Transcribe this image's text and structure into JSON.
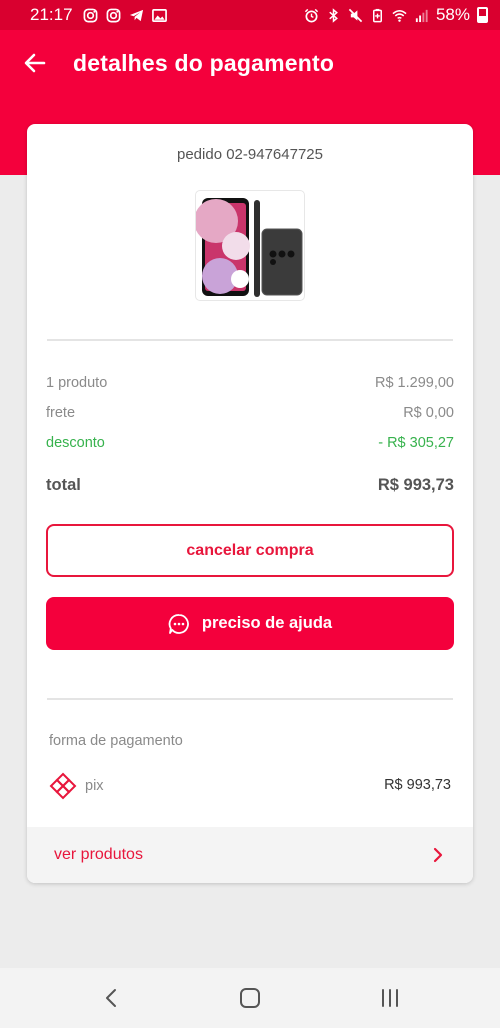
{
  "status": {
    "time": "21:17",
    "battery": "58%",
    "left_icons": [
      "instagram-icon",
      "instagram-icon",
      "telegram-icon",
      "gallery-icon"
    ],
    "right_icons": [
      "alarm-icon",
      "bluetooth-icon",
      "mute-icon",
      "battery-saver-icon",
      "wifi-icon",
      "signal-icon",
      "battery-icon"
    ]
  },
  "header": {
    "title": "detalhes do pagamento",
    "back_icon": "back-arrow-icon"
  },
  "order": {
    "id_label": "pedido 02-947647725",
    "product_image": "samsung-phone-image",
    "summary": [
      {
        "label": "1 produto",
        "value": "R$ 1.299,00"
      },
      {
        "label": "frete",
        "value": "R$ 0,00"
      },
      {
        "label": "desconto",
        "value": "- R$ 305,27"
      }
    ],
    "total": {
      "label": "total",
      "value": "R$ 993,73"
    }
  },
  "actions": {
    "cancel_label": "cancelar compra",
    "help_label": "preciso de ajuda",
    "help_icon": "chat-bubble-icon"
  },
  "payment": {
    "section_label": "forma de pagamento",
    "method": "pix",
    "method_icon": "pix-icon",
    "amount": "R$ 993,73"
  },
  "footer": {
    "link_label": "ver produtos",
    "chevron_icon": "chevron-right-icon"
  },
  "nav": {
    "icons": [
      "back-icon",
      "home-icon",
      "recents-icon"
    ]
  },
  "colors": {
    "brand": "#f4003c",
    "status_bar": "#d9002f",
    "discount": "#37b24d",
    "background": "#ececec"
  }
}
